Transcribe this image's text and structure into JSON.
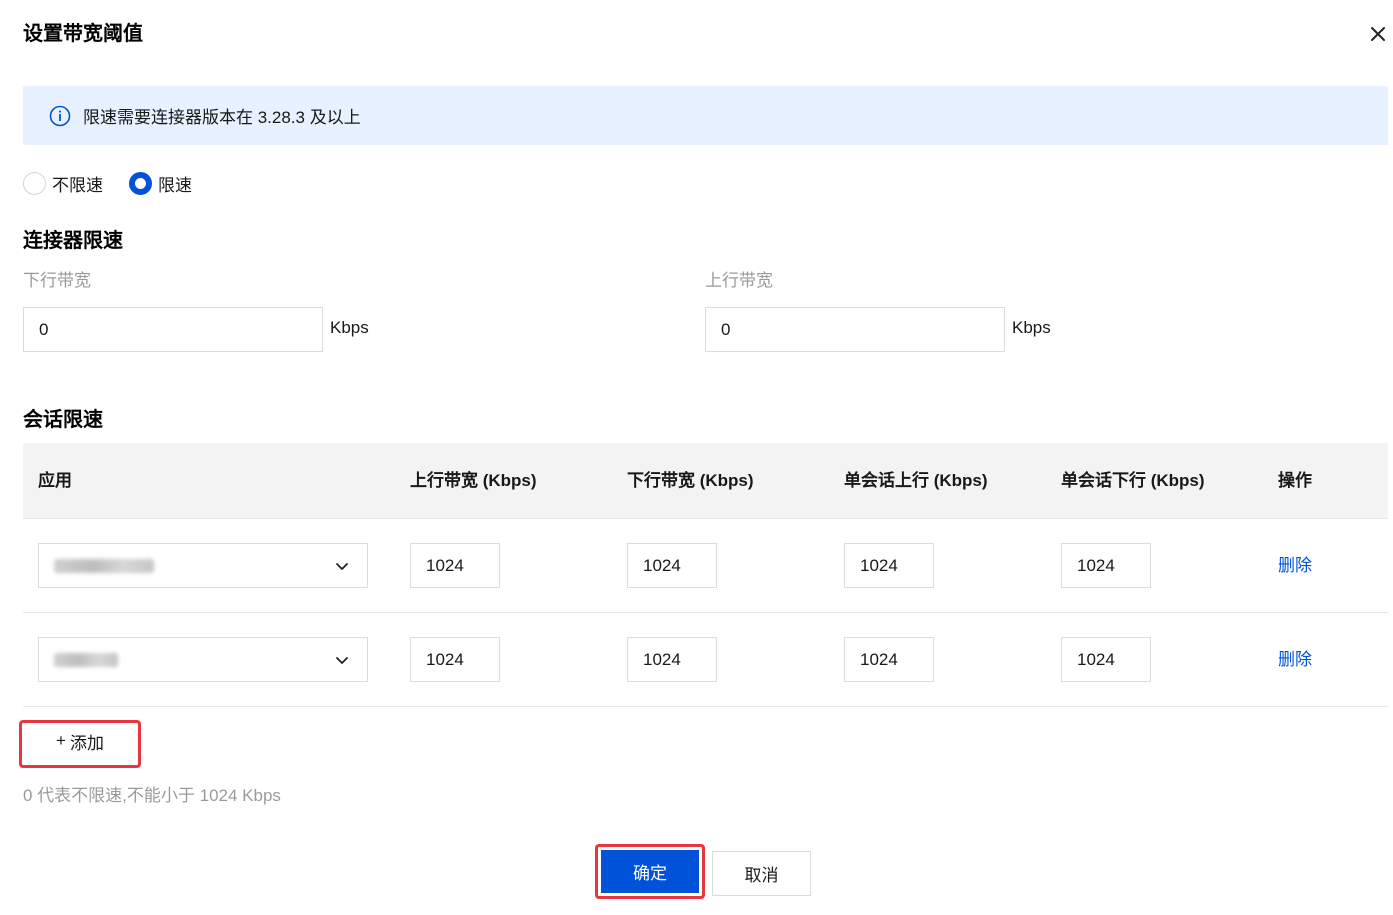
{
  "dialog": {
    "title": "设置带宽阈值",
    "close_icon": "close-icon"
  },
  "banner": {
    "icon": "info-circle-icon",
    "text": "限速需要连接器版本在 3.28.3 及以上",
    "bg_color": "#e8f1ff",
    "icon_color": "#0052d9"
  },
  "limit_mode": {
    "options": [
      {
        "label": "不限速",
        "checked": false
      },
      {
        "label": "限速",
        "checked": true
      }
    ]
  },
  "connector": {
    "title": "连接器限速",
    "downstream": {
      "label": "下行带宽",
      "value": "0",
      "unit": "Kbps"
    },
    "upstream": {
      "label": "上行带宽",
      "value": "0",
      "unit": "Kbps"
    }
  },
  "session": {
    "title": "会话限速",
    "columns": [
      "应用",
      "上行带宽 (Kbps)",
      "下行带宽 (Kbps)",
      "单会话上行 (Kbps)",
      "单会话下行 (Kbps)",
      "操作"
    ],
    "rows": [
      {
        "up": "1024",
        "down": "1024",
        "session_up": "1024",
        "session_down": "1024",
        "action": "删除"
      },
      {
        "up": "1024",
        "down": "1024",
        "session_up": "1024",
        "session_down": "1024",
        "action": "删除"
      }
    ]
  },
  "add_button": {
    "plus": "+",
    "label": "添加"
  },
  "hint": "0 代表不限速,不能小于 1024 Kbps",
  "footer": {
    "confirm_label": "确定",
    "cancel_label": "取消",
    "primary_color": "#0052d9",
    "highlight_color": "#e8363f"
  }
}
